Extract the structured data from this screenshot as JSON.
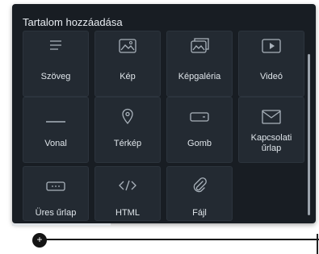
{
  "panel": {
    "title": "Tartalom hozzáadása",
    "tiles": [
      {
        "label": "Szöveg",
        "icon": "text-icon"
      },
      {
        "label": "Kép",
        "icon": "image-icon"
      },
      {
        "label": "Képgaléria",
        "icon": "gallery-icon"
      },
      {
        "label": "Videó",
        "icon": "video-icon"
      },
      {
        "label": "Vonal",
        "icon": "line-icon"
      },
      {
        "label": "Térkép",
        "icon": "map-pin-icon"
      },
      {
        "label": "Gomb",
        "icon": "button-icon"
      },
      {
        "label": "Kapcsolati űrlap",
        "icon": "envelope-icon"
      },
      {
        "label": "Üres űrlap",
        "icon": "blank-form-icon"
      },
      {
        "label": "HTML",
        "icon": "code-icon"
      },
      {
        "label": "Fájl",
        "icon": "paperclip-icon"
      }
    ]
  },
  "add_button": {
    "symbol": "+"
  },
  "colors": {
    "panel": "#181d23",
    "tile": "#232a32",
    "text": "#dfe5ea"
  }
}
